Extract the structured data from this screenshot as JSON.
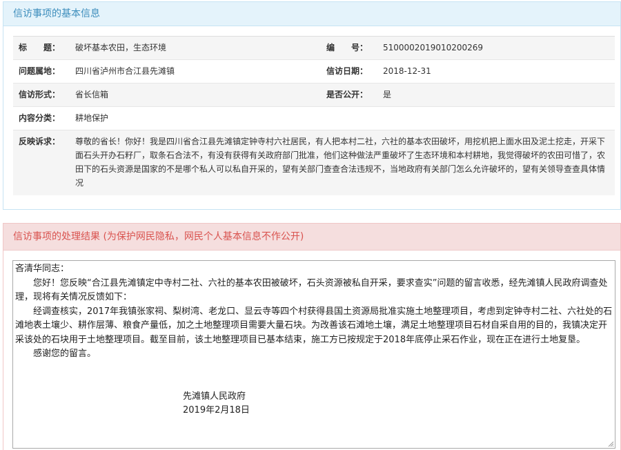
{
  "basic_info": {
    "title": "信访事项的基本信息",
    "rows": {
      "subject_label": "标　　题：",
      "subject_value": "破坏基本农田，生态环境",
      "number_label": "编　　号：",
      "number_value": "5100002019010200269",
      "location_label": "问题属地：",
      "location_value": "四川省泸州市合江县先滩镇",
      "date_label": "信访日期：",
      "date_value": "2018-12-31",
      "form_label": "信访形式：",
      "form_value": "省长信箱",
      "public_label": "是否公开：",
      "public_value": "是",
      "category_label": "内容分类：",
      "category_value": "耕地保护",
      "complaint_label": "反映诉求：",
      "complaint_value": "尊敬的省长！你好！我是四川省合江县先滩镇定钟寺村六社居民，有人把本村二社，六社的基本农田破坏，用挖机把上面水田及泥土挖走，开采下面石头开办石籽厂，取条石合法不，有没有获得有关政府部门批准，他们这种做法严重破坏了生态环境和本村耕地，我觉得破坏的农田可惜了，农田下的石头资源是国家的不是哪个私人可以私自开采的，望有关部门查查合法违规不，当地政府有关部门怎么允许破坏的，望有关领导查查具体情况"
    }
  },
  "result": {
    "title": "信访事项的处理结果",
    "note": "(为保护网民隐私，网民个人基本信息不作公开)",
    "reply": {
      "greeting": "吝清华同志：",
      "para1": "您好！您反映“合江县先滩镇定中寺村二社、六社的基本农田被破坏，石头资源被私自开采，要求查实”问题的留言收悉，经先滩镇人民政府调查处理，现将有关情况反馈如下：",
      "para2": "经调查核实，2017年我镇张家祠、梨树湾、老龙口、显云寺等四个村获得县国土资源局批准实施土地整理项目，考虑到定钟寺村二社、六社处的石滩地表土壤少、耕作层薄、粮食产量低，加之土地整理项目需要大量石块。为改善该石滩地土壤，满足土地整理项目石材自采自用的目的，我镇决定开采该处的石块用于土地整理项目。截至目前，该土地整理项目已基本结束，施工方已按规定于2018年底停止采石作业，现在正在进行土地复垦。",
      "para3": "感谢您的留言。",
      "signature_org": "先滩镇人民政府",
      "signature_date": "2019年2月18日"
    }
  },
  "colors": {
    "info_header_bg": "#e4f3fb",
    "info_header_text": "#3c8dbc",
    "result_header_bg": "#f5dede",
    "result_header_text": "#d9534f"
  }
}
